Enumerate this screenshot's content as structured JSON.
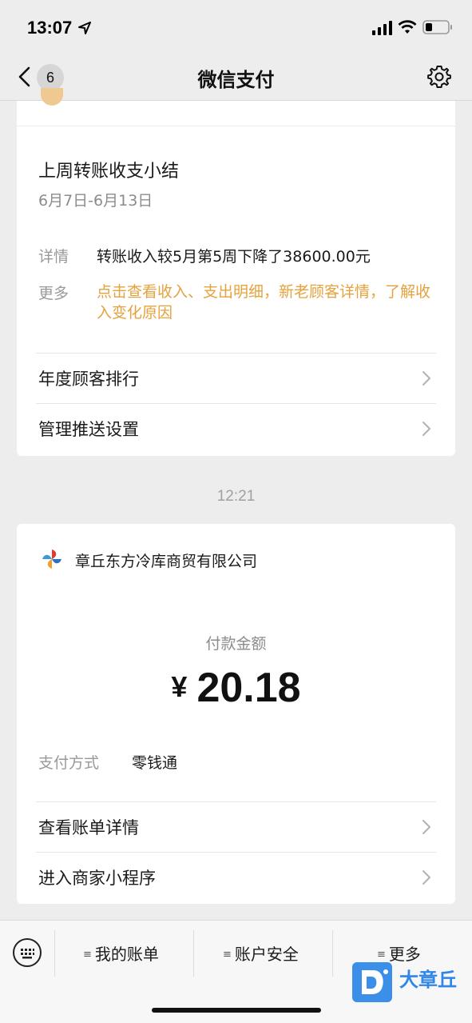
{
  "status_bar": {
    "time": "13:07"
  },
  "nav": {
    "back_count": "6",
    "title": "微信支付"
  },
  "summary_card": {
    "title": "上周转账收支小结",
    "date_range": "6月7日-6月13日",
    "detail_label": "详情",
    "detail_value": "转账收入较5月第5周下降了38600.00元",
    "more_label": "更多",
    "more_value": "点击查看收入、支出明细，新老顾客详情，了解收入变化原因",
    "links": [
      {
        "label": "年度顾客排行"
      },
      {
        "label": "管理推送设置"
      }
    ]
  },
  "timestamp": "12:21",
  "payment_card": {
    "merchant_name": "章丘东方冷库商贸有限公司",
    "amount_label": "付款金额",
    "currency": "¥",
    "amount": "20.18",
    "pay_method_label": "支付方式",
    "pay_method_value": "零钱通",
    "links": [
      {
        "label": "查看账单详情"
      },
      {
        "label": "进入商家小程序"
      }
    ]
  },
  "bottom_bar": {
    "menus": [
      {
        "label": "我的账单"
      },
      {
        "label": "账户安全"
      },
      {
        "label": "更多"
      }
    ]
  },
  "watermark": {
    "text": "大章丘",
    "color": "#2f86e8"
  },
  "colors": {
    "accent_orange": "#e6a23c",
    "background": "#ededed"
  }
}
